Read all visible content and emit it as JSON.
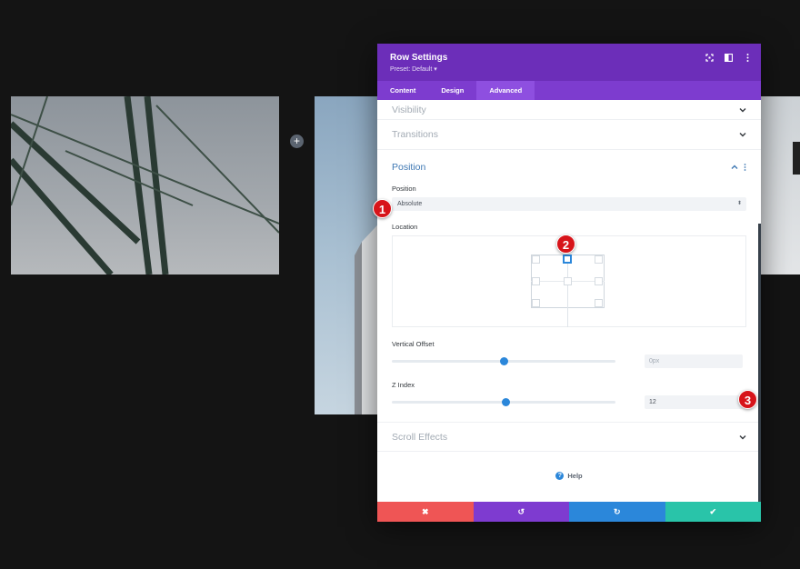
{
  "modal": {
    "title": "Row Settings",
    "preset": "Preset: Default ▾",
    "tabs": [
      {
        "label": "Content",
        "active": false
      },
      {
        "label": "Design",
        "active": false
      },
      {
        "label": "Advanced",
        "active": true
      }
    ]
  },
  "sections": {
    "visibility": "Visibility",
    "transitions": "Transitions",
    "position": "Position",
    "scroll_effects": "Scroll Effects"
  },
  "position_panel": {
    "position_label": "Position",
    "position_value": "Absolute",
    "location_label": "Location",
    "vertical_offset_label": "Vertical Offset",
    "vertical_offset_value": "0px",
    "vertical_offset_slider_pct": 50,
    "z_index_label": "Z Index",
    "z_index_value": "12",
    "z_index_slider_pct": 51,
    "selected_location": "top-center"
  },
  "help": {
    "label": "Help",
    "icon": "?"
  },
  "footer": {
    "cancel": "✖",
    "undo": "↺",
    "redo": "↻",
    "save": "✔"
  },
  "markers": [
    "1",
    "2",
    "3"
  ],
  "colors": {
    "header": "#6c2eb9",
    "tabs": "#7d3ccf",
    "accent": "#2b87da",
    "marker": "#d7141a"
  },
  "canvas": {
    "add_button": "+"
  }
}
